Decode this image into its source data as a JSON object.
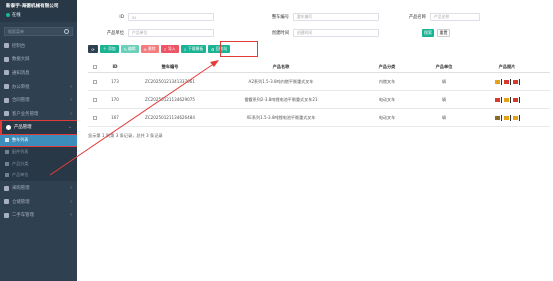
{
  "sidebar": {
    "company": "新泰宇-海德机械有限公司",
    "status": "在线",
    "search_placeholder": "搜索菜单",
    "menu_top": [
      {
        "label": "控制台"
      },
      {
        "label": "数据大屏"
      },
      {
        "label": "通知消息"
      },
      {
        "label": "办公审批"
      },
      {
        "label": "合同管理"
      },
      {
        "label": "客户业务管理"
      }
    ],
    "menu_active": {
      "label": "产品管理"
    },
    "sub_items": [
      {
        "label": "整车列表"
      },
      {
        "label": "配件列表"
      },
      {
        "label": "产品分类"
      },
      {
        "label": "产品单位"
      }
    ],
    "menu_bottom": [
      {
        "label": "采购管理"
      },
      {
        "label": "仓储管理"
      },
      {
        "label": "二手车管理"
      }
    ]
  },
  "filters": {
    "id_label": "ID",
    "id_placeholder": "ID",
    "vehicle_no_label": "整车编号",
    "vehicle_no_placeholder": "整车编号",
    "name_label": "产品名称",
    "name_placeholder": "产品名称",
    "unit_label": "产品单位",
    "unit_placeholder": "产品单位",
    "created_label": "创建时间",
    "created_placeholder": "创建时间",
    "search_btn": "搜索",
    "reset_btn": "重置"
  },
  "toolbar": {
    "add": "添加",
    "edit": "编辑",
    "delete": "删除",
    "import": "导入",
    "download_template": "下载模板",
    "recycle": "回收站"
  },
  "table": {
    "headers": [
      "",
      "ID",
      "整车编号",
      "产品名称",
      "产品分类",
      "产品单位",
      "产品图片"
    ],
    "rows": [
      {
        "id": "173",
        "code": "ZC20250121341337061",
        "name": "A2系列1.5-3.8吨内燃平衡重式叉车",
        "category": "内燃叉车",
        "unit": "辆"
      },
      {
        "id": "170",
        "code": "ZC20250121134629075",
        "name": "雷霆系列2-3.8吨锂电池平衡重式叉车21",
        "category": "电动叉车",
        "unit": "辆"
      },
      {
        "id": "167",
        "code": "ZC20250121134626484",
        "name": "XE系列1.5-3.8吨锂电池平衡重式叉车",
        "category": "电动叉车",
        "unit": "辆"
      }
    ]
  },
  "pager": "显示第 1 到第 3 条记录，总共 3 条记录",
  "colors": {
    "sidebar": "#2f4050",
    "accent": "#1ab394",
    "highlight": "#e23b3b"
  }
}
